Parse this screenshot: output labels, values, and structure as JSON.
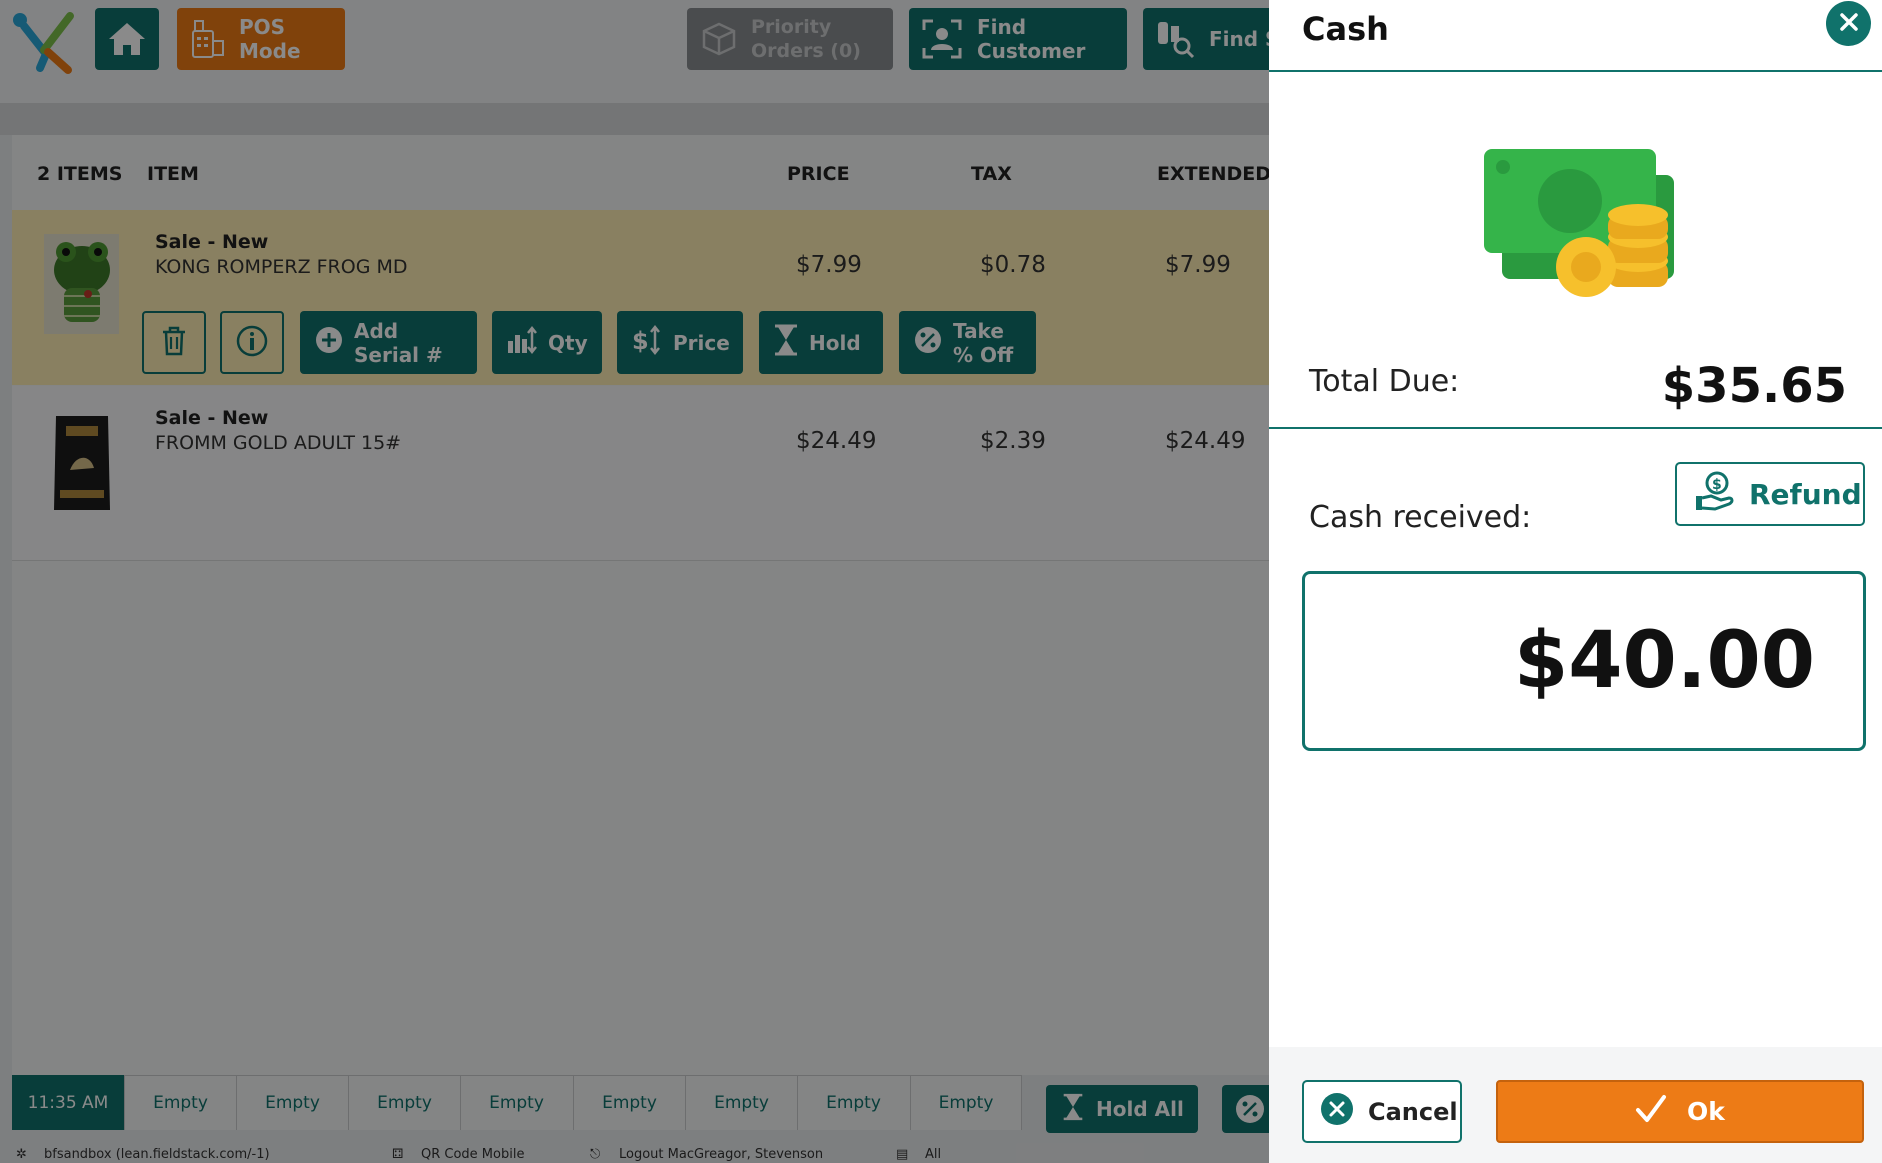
{
  "header": {
    "pos_mode_label": "POS Mode",
    "priority_line1": "Priority",
    "priority_line2": "Orders (0)",
    "find_customer_label": "Find Customer",
    "find_s_label": "Find S"
  },
  "cart": {
    "columns": {
      "count": "2 ITEMS",
      "item": "ITEM",
      "price": "PRICE",
      "tax": "TAX",
      "extended": "EXTENDED"
    },
    "items": [
      {
        "type": "Sale - New",
        "name": "KONG ROMPERZ FROG MD",
        "price": "$7.99",
        "tax": "$0.78",
        "extended": "$7.99"
      },
      {
        "type": "Sale - New",
        "name": "FROMM GOLD ADULT 15#",
        "price": "$24.49",
        "tax": "$2.39",
        "extended": "$24.49"
      }
    ],
    "actions": {
      "add_serial_line1": "Add",
      "add_serial_line2": "Serial #",
      "qty": "Qty",
      "price": "Price",
      "hold": "Hold",
      "take_off_line1": "Take",
      "take_off_line2": "% Off"
    }
  },
  "bottom": {
    "time": "11:35 AM",
    "slots": [
      "Empty",
      "Empty",
      "Empty",
      "Empty",
      "Empty",
      "Empty",
      "Empty",
      "Empty"
    ],
    "hold_all": "Hold All"
  },
  "statusbar": {
    "server": "bfsandbox (lean.fieldstack.com/-1)",
    "qr": "QR Code Mobile",
    "logout": "Logout MacGreagor, Stevenson",
    "all": "All"
  },
  "dialog": {
    "title": "Cash",
    "total_due_label": "Total Due:",
    "total_due_value": "$35.65",
    "cash_received_label": "Cash received:",
    "cash_received_value": "$40.00",
    "refund_label": "Refund",
    "cancel_label": "Cancel",
    "ok_label": "Ok"
  },
  "colors": {
    "teal": "#10726b",
    "orange": "#ed7b16",
    "highlight_row": "#fdecb4",
    "cash_green": "#35b44a",
    "coin_gold": "#f6c02c"
  }
}
